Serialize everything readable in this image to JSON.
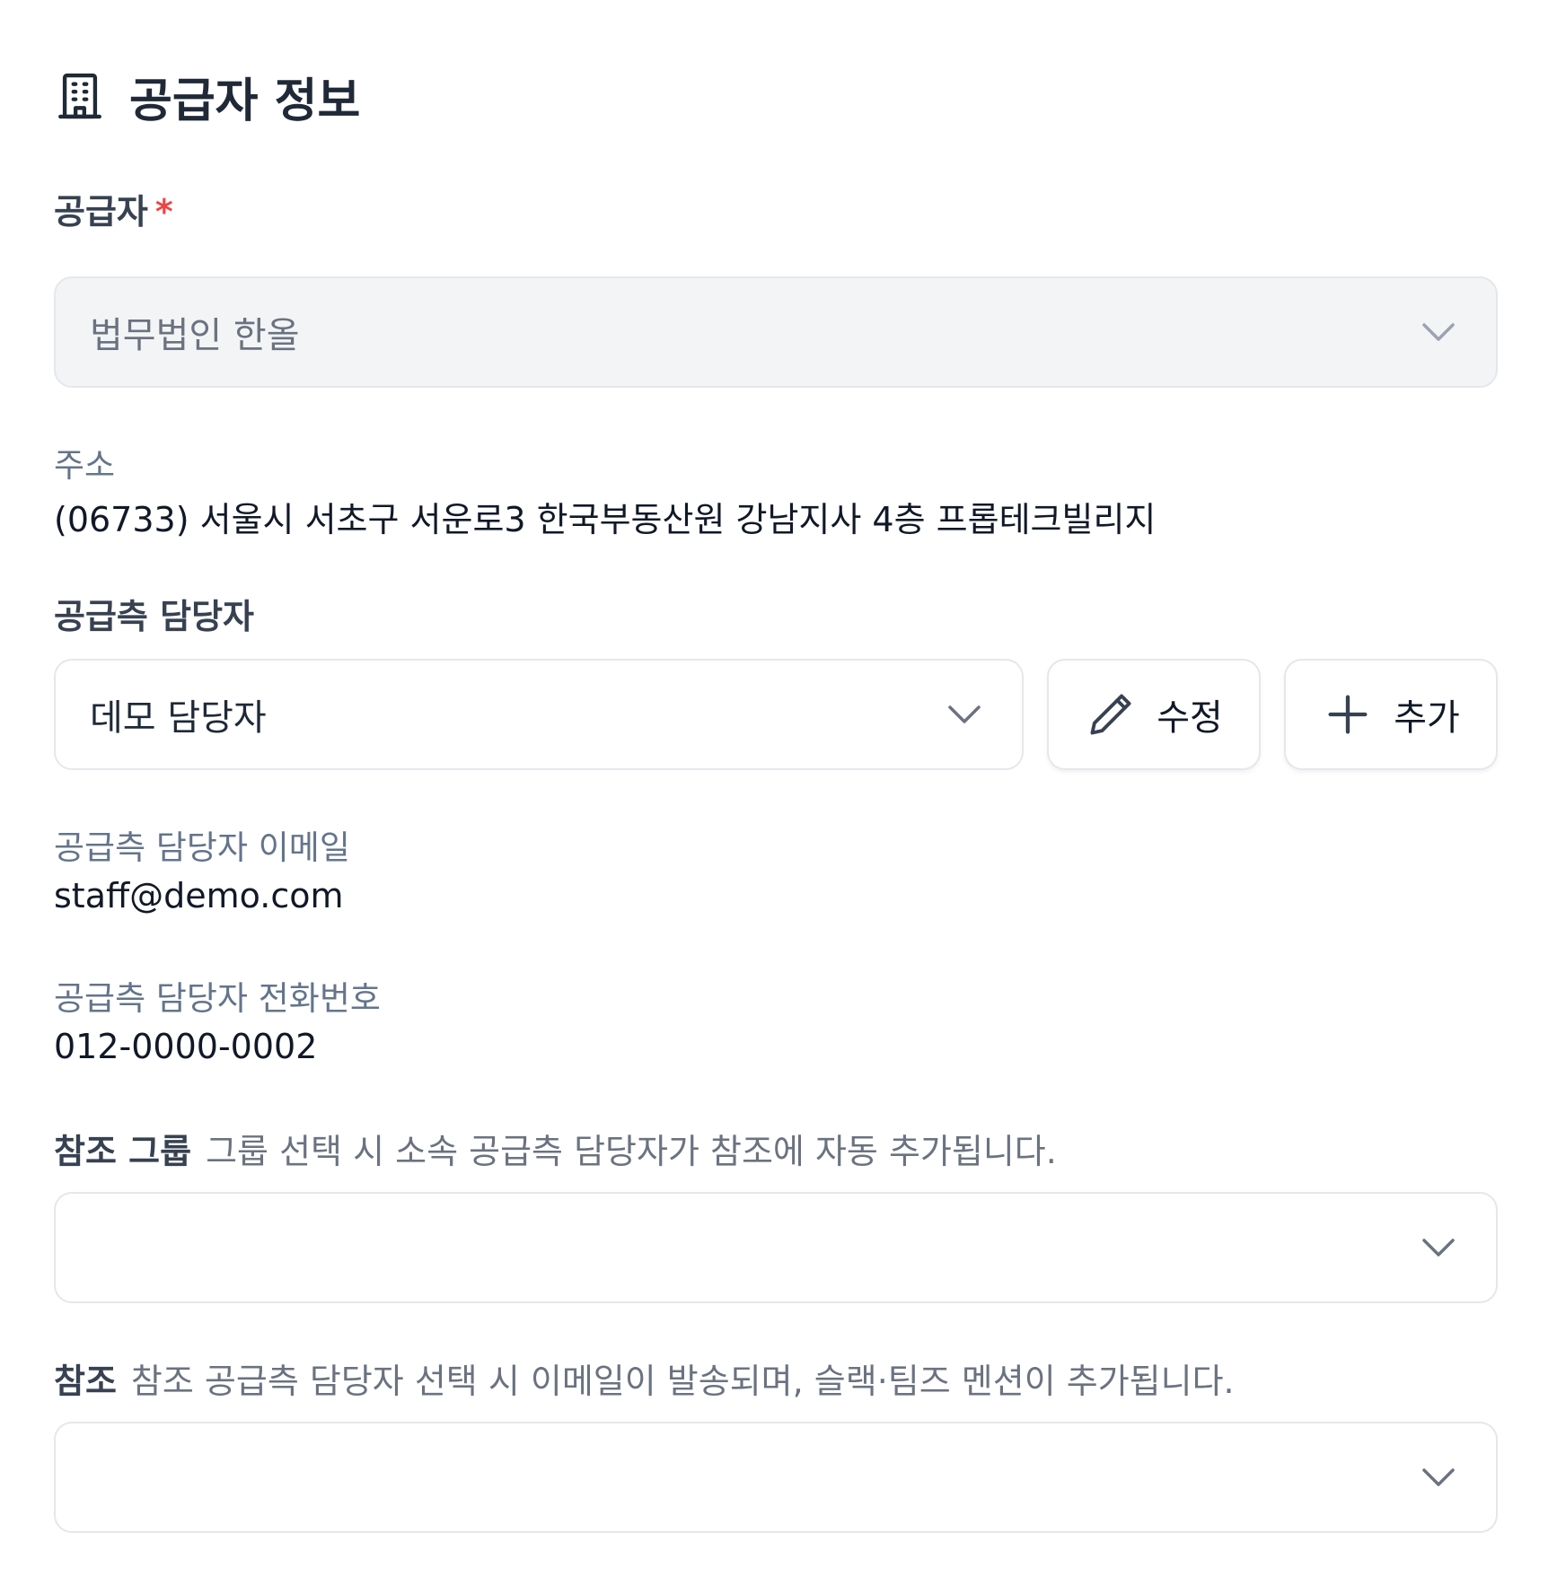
{
  "section": {
    "title": "공급자 정보",
    "icon": "building-icon"
  },
  "supplier": {
    "label": "공급자",
    "required_mark": "*",
    "value": "법무법인 한올"
  },
  "address": {
    "label": "주소",
    "value": "(06733) 서울시 서초구 서운로3 한국부동산원 강남지사 4층 프롭테크빌리지"
  },
  "contact": {
    "label": "공급측 담당자",
    "value": "데모 담당자",
    "edit_label": "수정",
    "add_label": "추가"
  },
  "contact_email": {
    "label": "공급측 담당자 이메일",
    "value": "staff@demo.com"
  },
  "contact_phone": {
    "label": "공급측 담당자 전화번호",
    "value": "012-0000-0002"
  },
  "cc_group": {
    "label": "참조 그룹",
    "hint": "그룹 선택 시 소속 공급측 담당자가 참조에 자동 추가됩니다.",
    "value": ""
  },
  "cc": {
    "label": "참조",
    "hint": "참조 공급측 담당자 선택 시 이메일이 발송되며, 슬랙·팀즈 멘션이 추가됩니다.",
    "value": ""
  },
  "colors": {
    "required": "#ef4444",
    "muted_label": "#64748b",
    "disabled_bg": "#f3f4f6",
    "border": "#e5e7eb"
  }
}
